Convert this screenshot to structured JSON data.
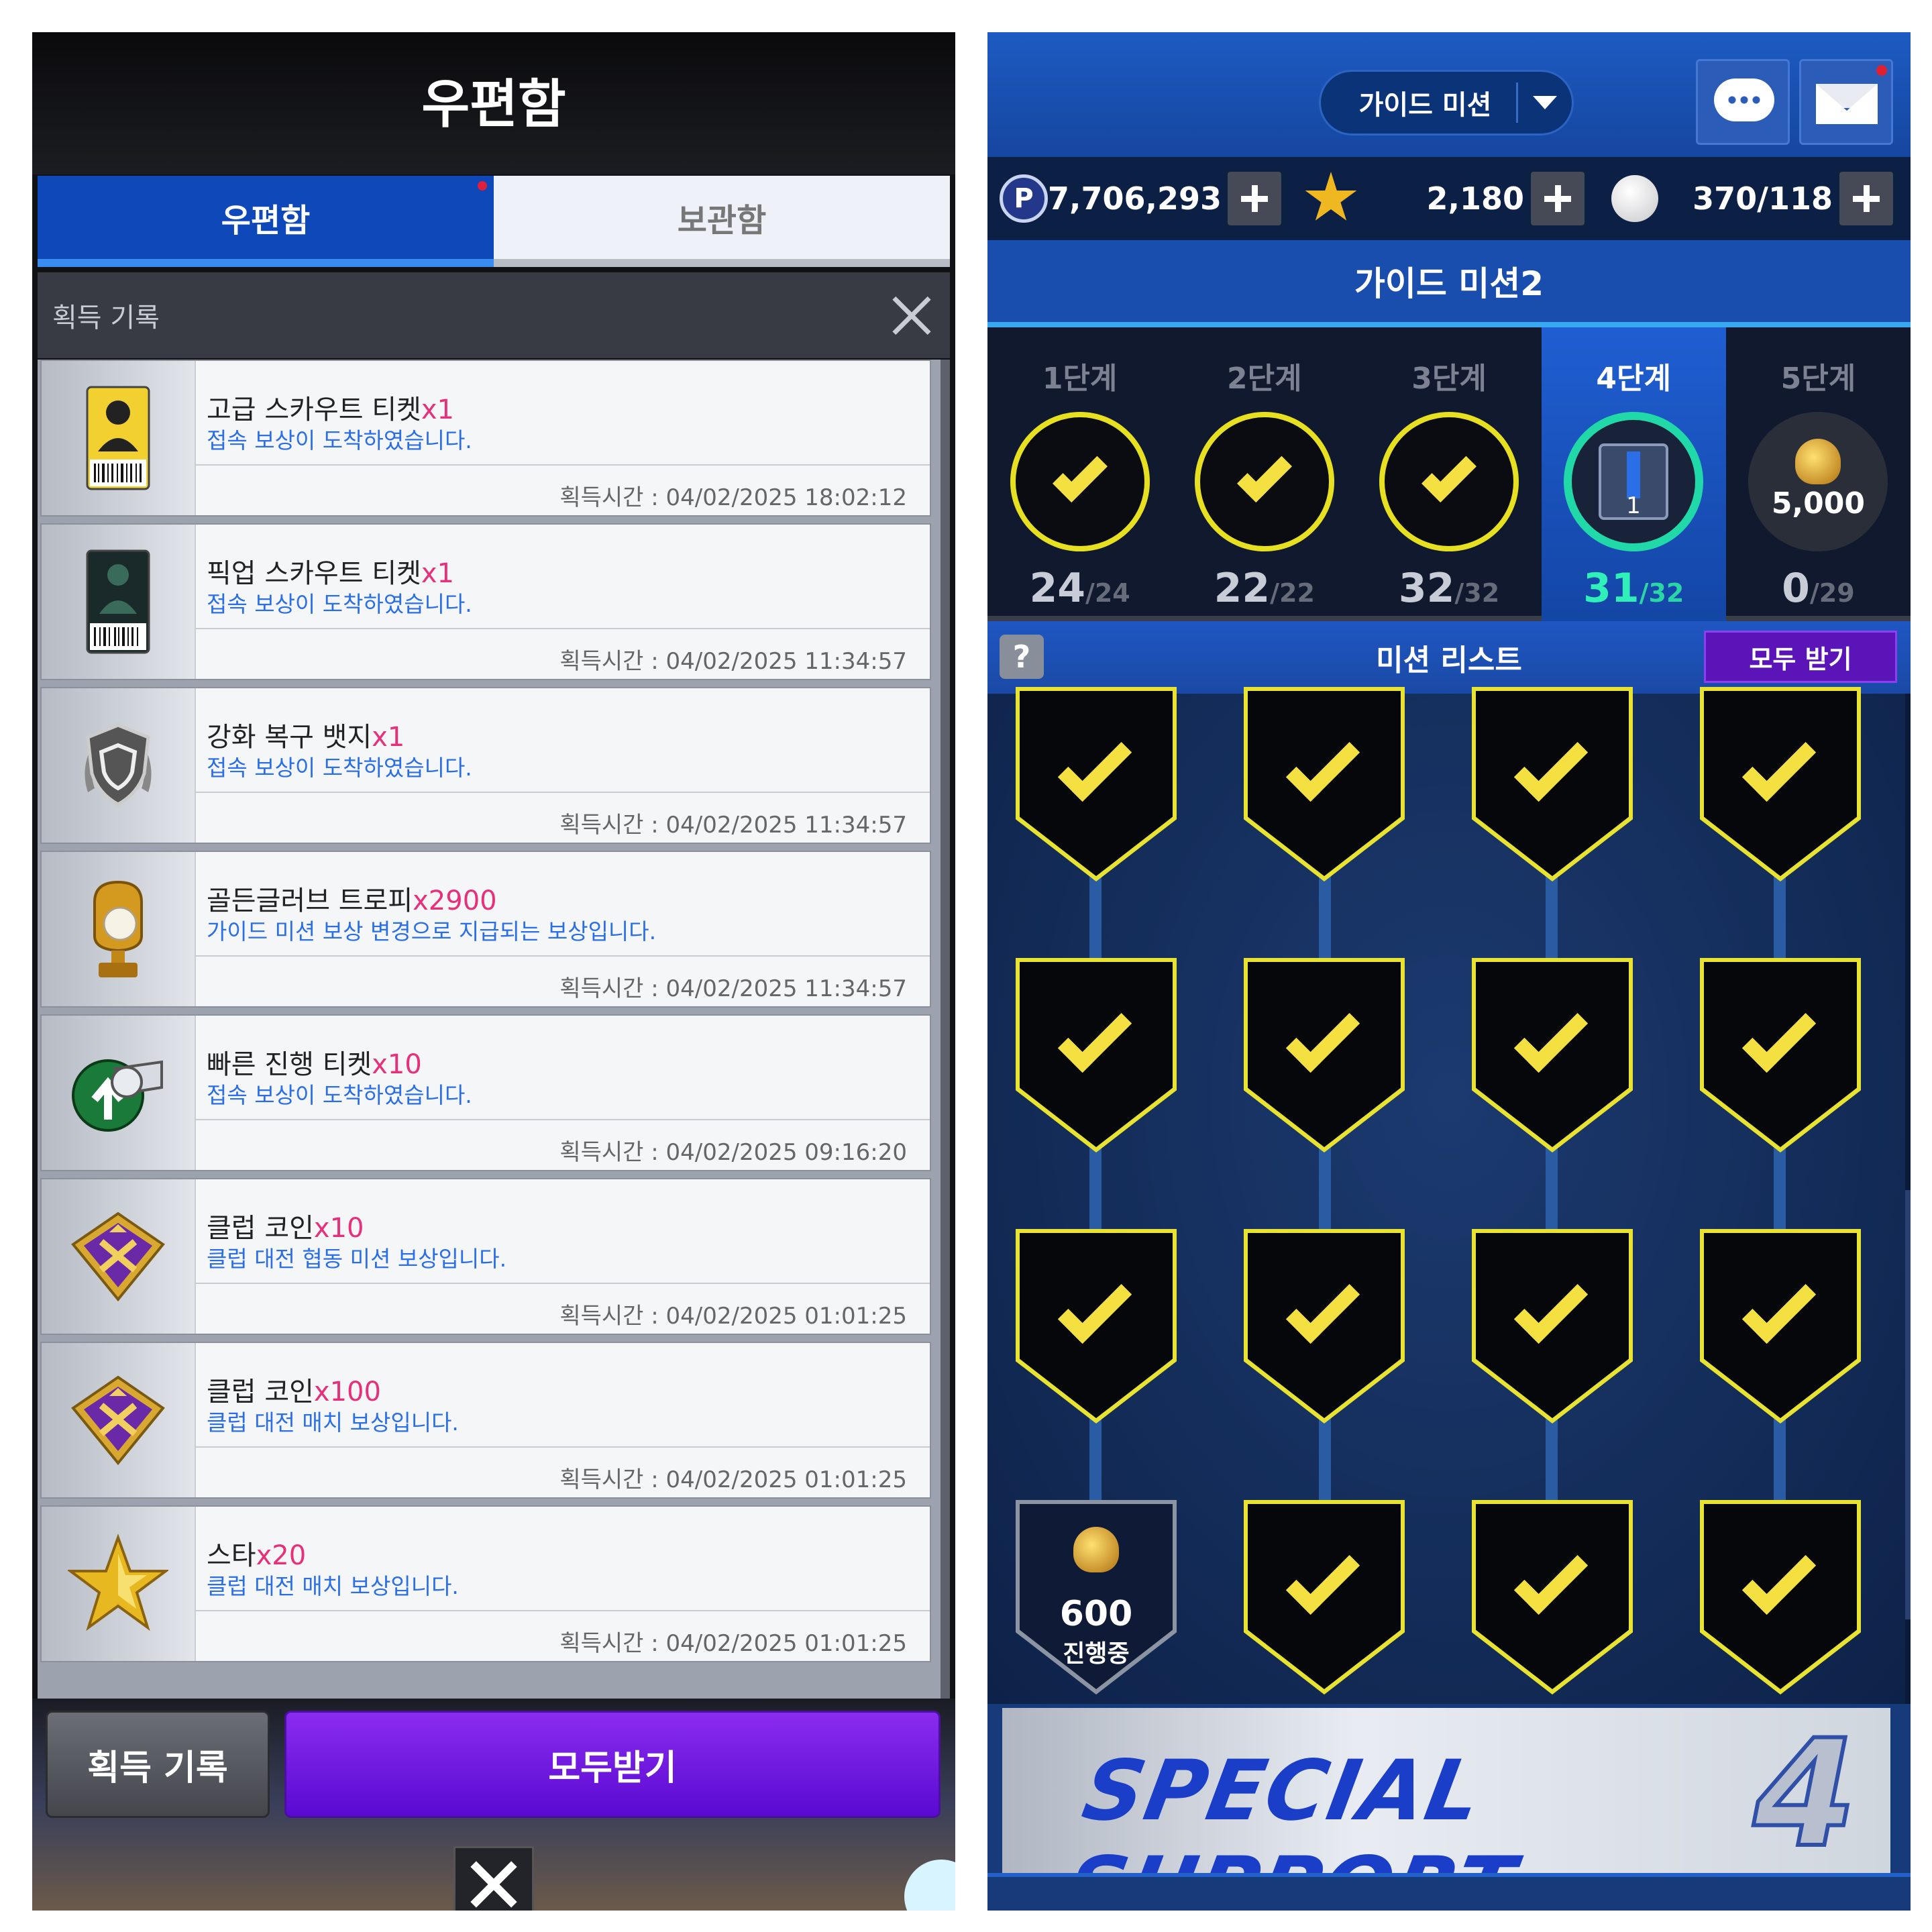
{
  "left": {
    "title": "우편함",
    "tabs": [
      {
        "label": "우편함"
      },
      {
        "label": "보관함"
      }
    ],
    "sub_title": "획득 기록",
    "mails": [
      {
        "name": "고급 스카우트 티켓",
        "qty": "x1",
        "desc": "접속 보상이 도착하였습니다.",
        "time": "획득시간 : 04/02/2025 18:02:12",
        "icon": "scout-ticket-gold-icon"
      },
      {
        "name": "픽업 스카우트 티켓",
        "qty": "x1",
        "desc": "접속 보상이 도착하였습니다.",
        "time": "획득시간 : 04/02/2025 11:34:57",
        "icon": "pickup-scout-ticket-icon"
      },
      {
        "name": "강화 복구 뱃지",
        "qty": "x1",
        "desc": "접속 보상이 도착하였습니다.",
        "time": "획득시간 : 04/02/2025 11:34:57",
        "icon": "shield-badge-icon"
      },
      {
        "name": "골든글러브 트로피",
        "qty": "x2900",
        "desc": "가이드 미션 보상 변경으로 지급되는 보상입니다.",
        "time": "획득시간 : 04/02/2025 11:34:57",
        "icon": "golden-glove-trophy-icon"
      },
      {
        "name": "빠른 진행 티켓",
        "qty": "x10",
        "desc": "접속 보상이 도착하였습니다.",
        "time": "획득시간 : 04/02/2025 09:16:20",
        "icon": "whistle-icon"
      },
      {
        "name": "클럽 코인",
        "qty": "x10",
        "desc": "클럽 대전 협동 미션 보상입니다.",
        "time": "획득시간 : 04/02/2025 01:01:25",
        "icon": "club-coin-icon"
      },
      {
        "name": "클럽 코인",
        "qty": "x100",
        "desc": "클럽 대전 매치 보상입니다.",
        "time": "획득시간 : 04/02/2025 01:01:25",
        "icon": "club-coin-icon"
      },
      {
        "name": "스타",
        "qty": "x20",
        "desc": "클럽 대전 매치 보상입니다.",
        "time": "획득시간 : 04/02/2025 01:01:25",
        "icon": "star-icon"
      }
    ],
    "buttons": {
      "record": "획득 기록",
      "receive_all": "모두받기"
    }
  },
  "right": {
    "dropdown_label": "가이드 미션",
    "resources": {
      "points": "7,706,293",
      "stars": "2,180",
      "balls": "370/118",
      "points_icon_letter": "P"
    },
    "mission_title": "가이드 미션2",
    "stages": [
      {
        "label": "1단계",
        "done": "24",
        "total": "/24",
        "state": "complete"
      },
      {
        "label": "2단계",
        "done": "22",
        "total": "/22",
        "state": "complete"
      },
      {
        "label": "3단계",
        "done": "32",
        "total": "/32",
        "state": "complete"
      },
      {
        "label": "4단계",
        "done": "31",
        "total": "/32",
        "state": "active"
      },
      {
        "label": "5단계",
        "done": "0",
        "total": "/29",
        "state": "locked",
        "reward": "5,000"
      }
    ],
    "list_title": "미션 리스트",
    "help_label": "?",
    "receive_all": "모두 받기",
    "progress_mission": {
      "value": "600",
      "status": "진행중"
    },
    "banner_text": "SPECIAL SUPPORT",
    "banner_number": "4",
    "colors": {
      "accent_yellow": "#e8e230",
      "active_teal": "#20d8a8",
      "purple": "#5a14b8"
    }
  }
}
